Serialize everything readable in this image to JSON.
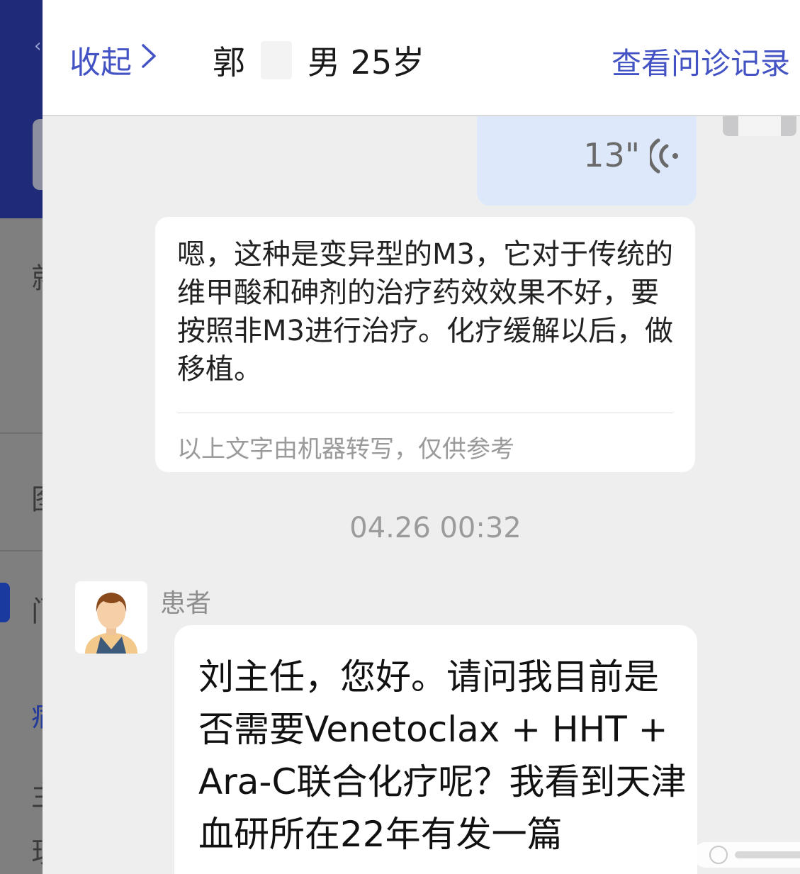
{
  "header": {
    "collapse_label": "收起",
    "patient_surname": "郭",
    "patient_info": "男 25岁",
    "history_link": "查看问诊记录"
  },
  "messages": {
    "voice": {
      "duration": "13\""
    },
    "transcript": {
      "text": "嗯，这种是变异型的M3，它对于传统的维甲酸和砷剂的治疗药效效果不好，要按照非M3进行治疗。化疗缓解以后，做移植。",
      "note": "以上文字由机器转写，仅供参考"
    },
    "timestamp": "04.26 00:32",
    "patient_message": {
      "sender": "患者",
      "text": "刘主任，您好。请问我目前是否需要Venetoclax + HHT + Ara-C联合化疗呢？我看到天津血研所在22年有发一篇"
    }
  },
  "colors": {
    "accent": "#4453c4",
    "voice_bubble": "#dde9fb",
    "panel_bg": "#eeeeee"
  },
  "icons": {
    "collapse": "chevron-right-icon",
    "voice": "voice-wave-icon",
    "doctor_avatar": "doctor-avatar",
    "patient_avatar": "patient-avatar"
  }
}
